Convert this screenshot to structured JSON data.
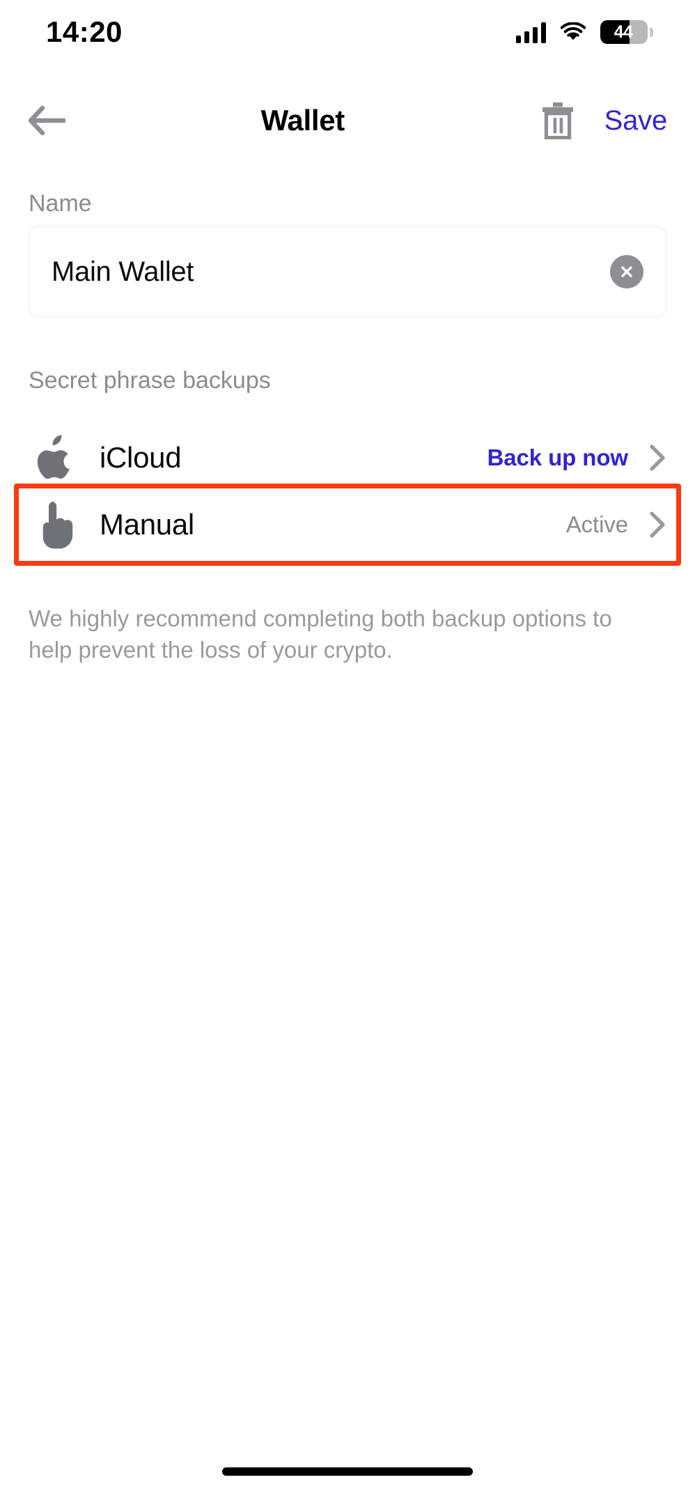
{
  "status_bar": {
    "time": "14:20",
    "battery_level": "44",
    "signal_icon": "cellular-signal-icon",
    "wifi_icon": "wifi-icon",
    "battery_icon": "battery-icon"
  },
  "nav": {
    "back_icon": "arrow-left-icon",
    "title": "Wallet",
    "trash_icon": "trash-icon",
    "save_label": "Save"
  },
  "form": {
    "name_label": "Name",
    "name_value": "Main Wallet",
    "name_placeholder": "Name",
    "clear_icon": "clear-circle-icon"
  },
  "backups": {
    "section_label": "Secret phrase backups",
    "rows": [
      {
        "icon": "apple-icon",
        "label": "iCloud",
        "status": "Back up now",
        "status_style": "link",
        "chevron_icon": "chevron-right-icon"
      },
      {
        "icon": "pointing-hand-icon",
        "label": "Manual",
        "status": "Active",
        "status_style": "muted",
        "chevron_icon": "chevron-right-icon"
      }
    ],
    "helper_text": "We highly recommend completing both backup options to help prevent the loss of your crypto."
  },
  "colors": {
    "accent": "#3122d4",
    "highlight": "#f93a12",
    "muted": "#8c8c8c",
    "text": "#0a0a0a"
  }
}
